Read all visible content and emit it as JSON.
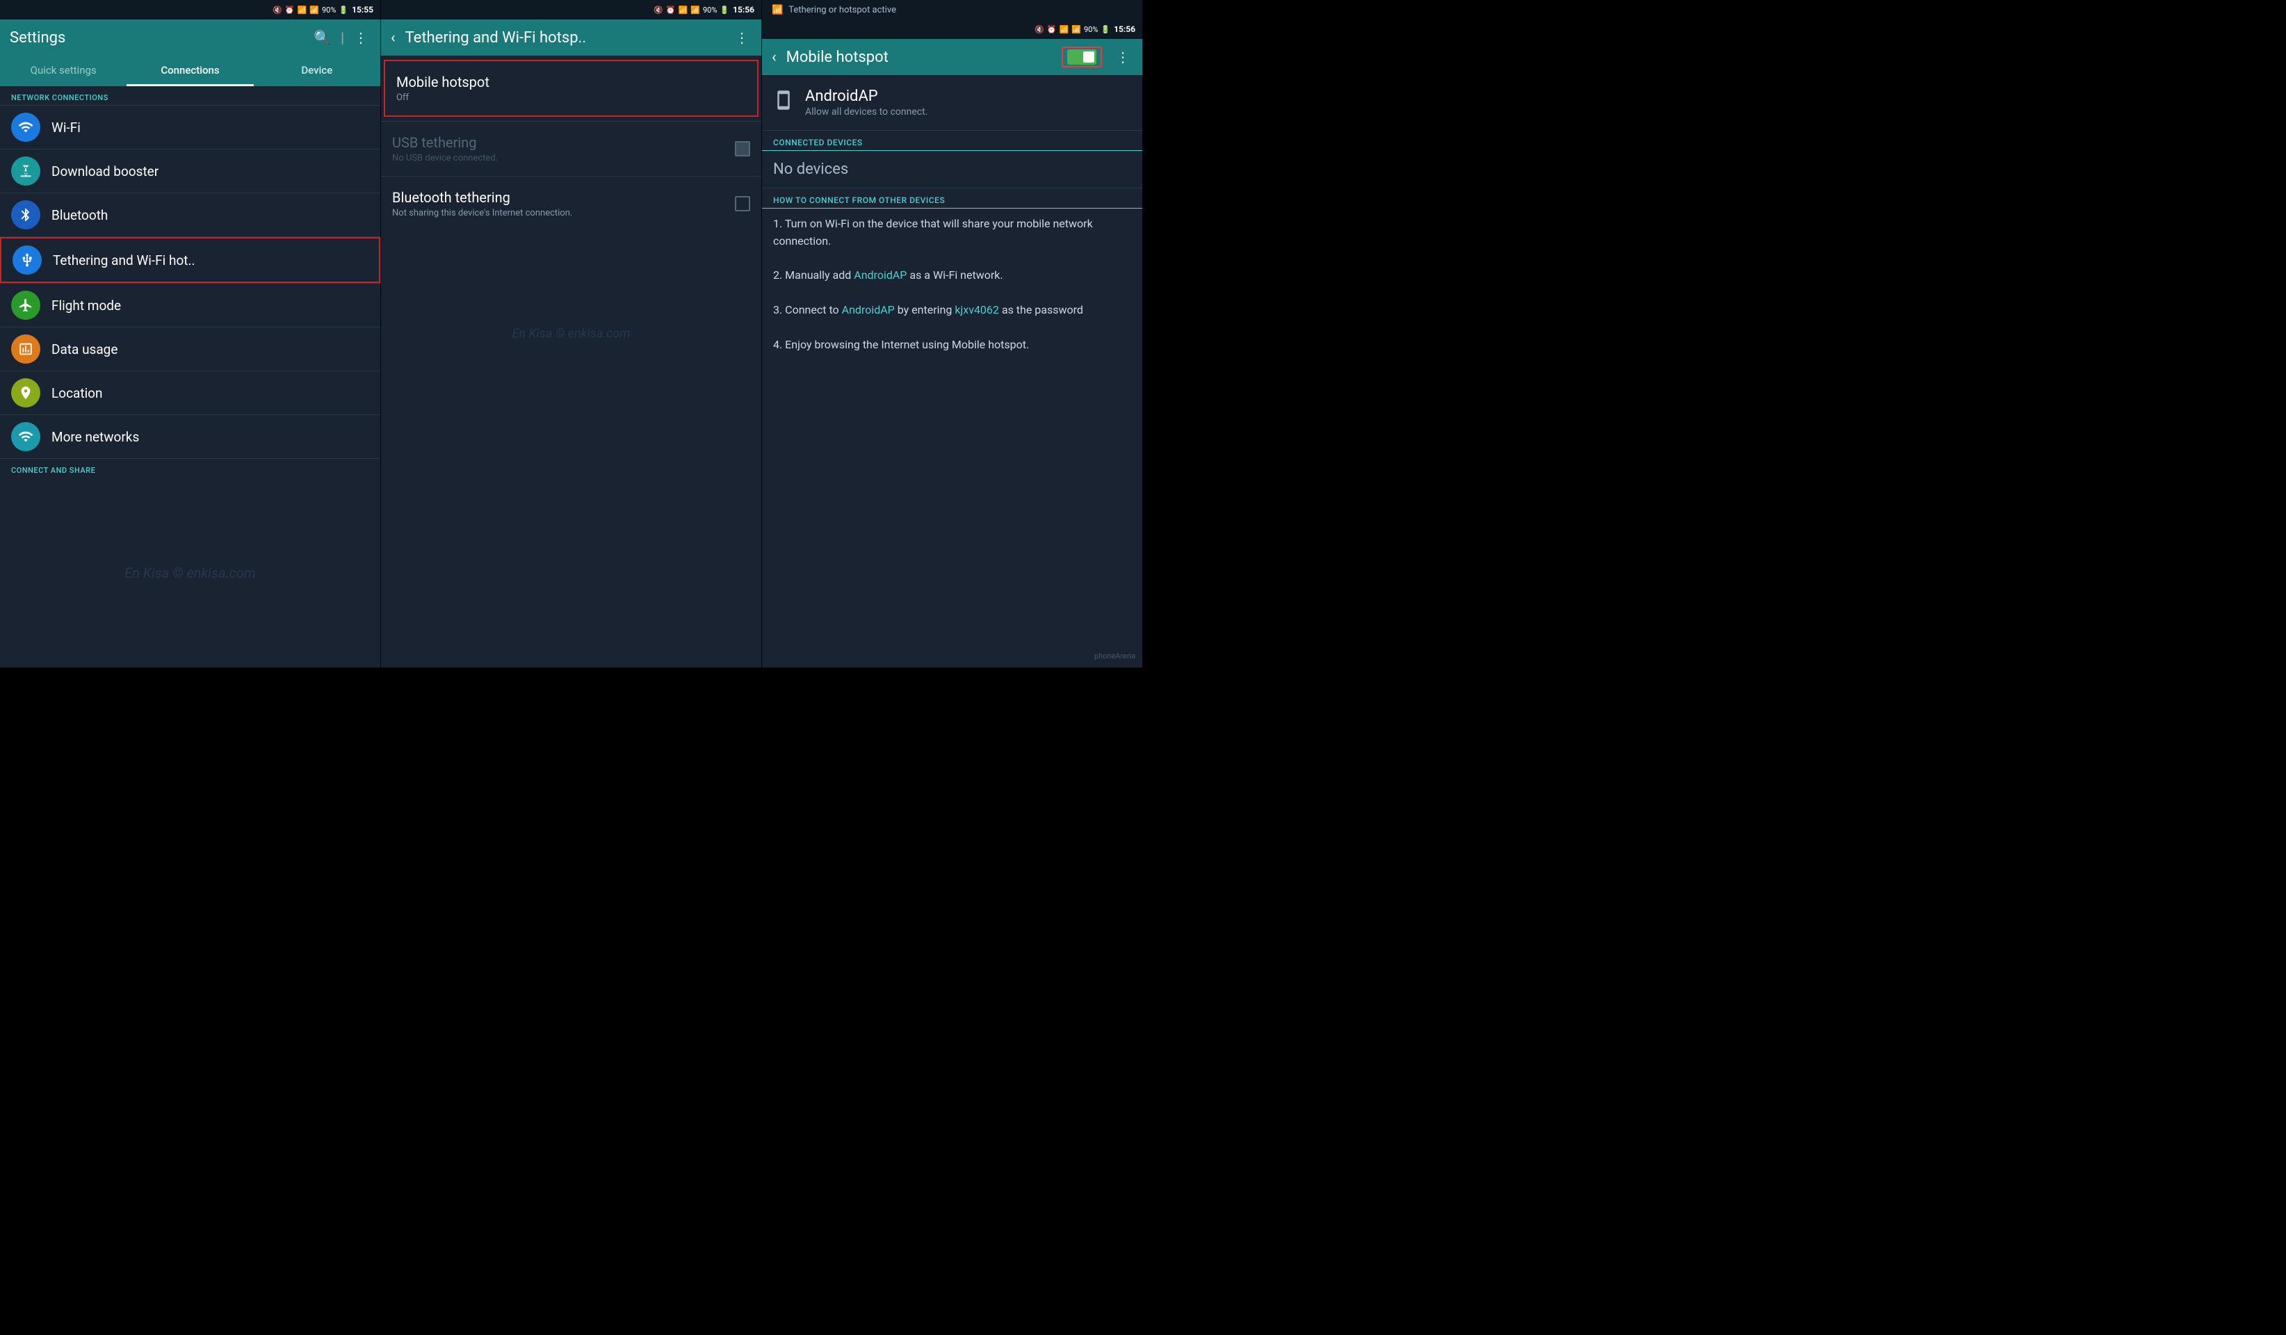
{
  "panel1": {
    "status": {
      "time": "15:55",
      "battery": "90%"
    },
    "topbar": {
      "title": "Settings",
      "search_label": "🔍",
      "menu_label": "⋮"
    },
    "tabs": [
      {
        "label": "Quick settings",
        "active": false
      },
      {
        "label": "Connections",
        "active": true
      },
      {
        "label": "Device",
        "active": false
      }
    ],
    "section_network": "NETWORK CONNECTIONS",
    "items": [
      {
        "icon": "wifi",
        "title": "Wi-Fi",
        "sub": "",
        "icon_class": "icon-blue",
        "selected": false
      },
      {
        "icon": "⚡",
        "title": "Download booster",
        "sub": "",
        "icon_class": "icon-teal",
        "selected": false
      },
      {
        "icon": "✱",
        "title": "Bluetooth",
        "sub": "",
        "icon_class": "icon-blue2",
        "selected": false
      },
      {
        "icon": "📡",
        "title": "Tethering and Wi-Fi hot..",
        "sub": "",
        "icon_class": "icon-blue3",
        "selected": true
      },
      {
        "icon": "✈",
        "title": "Flight mode",
        "sub": "",
        "icon_class": "icon-green",
        "selected": false
      },
      {
        "icon": "📊",
        "title": "Data usage",
        "sub": "",
        "icon_class": "icon-orange",
        "selected": false
      },
      {
        "icon": "📍",
        "title": "Location",
        "sub": "",
        "icon_class": "icon-lime",
        "selected": false
      },
      {
        "icon": "🔗",
        "title": "More networks",
        "sub": "",
        "icon_class": "icon-cyan",
        "selected": false
      }
    ],
    "section_connect": "CONNECT AND SHARE",
    "watermark": "En Kisa © enkisa.com"
  },
  "panel2": {
    "status": {
      "time": "15:56",
      "battery": "90%"
    },
    "topbar": {
      "title": "Tethering and Wi-Fi hotsp..",
      "menu_label": "⋮"
    },
    "items": [
      {
        "title": "Mobile hotspot",
        "sub": "Off",
        "has_toggle": false,
        "selected": true
      },
      {
        "title": "USB tethering",
        "sub": "No USB device connected.",
        "has_checkbox": true,
        "checked": true,
        "disabled": true
      },
      {
        "title": "Bluetooth tethering",
        "sub": "Not sharing this device's Internet connection.",
        "has_checkbox": true,
        "checked": false,
        "disabled": false
      }
    ],
    "watermark": "En Kisa © enkisa.com"
  },
  "panel3": {
    "notification": "Tethering or hotspot active",
    "status": {
      "time": "15:56",
      "battery": "90%"
    },
    "topbar": {
      "title": "Mobile hotspot",
      "menu_label": "⋮",
      "toggle_on": true
    },
    "ap_name": "AndroidAP",
    "ap_sub": "Allow all devices to connect.",
    "connected_devices_label": "CONNECTED DEVICES",
    "no_devices_label": "No devices",
    "how_to_label": "HOW TO CONNECT FROM OTHER DEVICES",
    "instructions": [
      "1. Turn on Wi-Fi on the device that will share your mobile network connection.",
      "2. Manually add ",
      "AndroidAP",
      " as a Wi-Fi network.",
      "3. Connect to ",
      "AndroidAP",
      " by entering ",
      "kjxv4062",
      " as the password",
      "4. Enjoy browsing the Internet using Mobile hotspot."
    ],
    "phoneArena": "phoneArena"
  }
}
